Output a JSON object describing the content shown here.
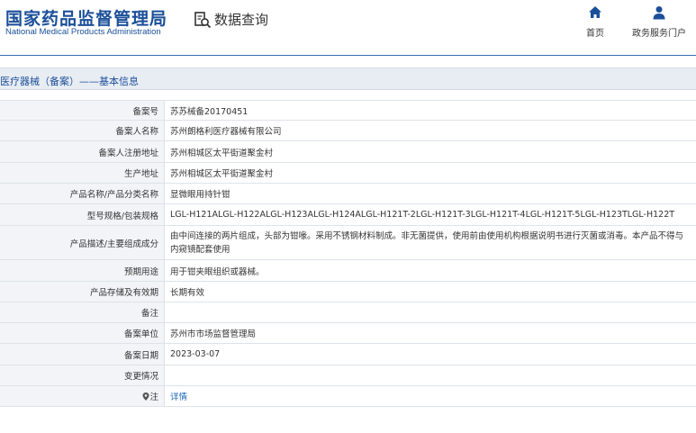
{
  "header": {
    "title": "国家药品监督管理局",
    "subtitle": "National Medical Products Administration",
    "query_label": "数据查询",
    "nav": [
      {
        "label": "首页",
        "icon": "home-icon"
      },
      {
        "label": "政务服务门户",
        "icon": "user-icon"
      }
    ]
  },
  "section": {
    "title": "医疗器械（备案）——基本信息"
  },
  "rows": [
    {
      "key": "备案号",
      "value": "苏苏械备20170451"
    },
    {
      "key": "备案人名称",
      "value": "苏州朗格利医疗器械有限公司"
    },
    {
      "key": "备案人注册地址",
      "value": "苏州相城区太平街道聚金村"
    },
    {
      "key": "生产地址",
      "value": "苏州相城区太平街道聚金村"
    },
    {
      "key": "产品名称/产品分类名称",
      "value": "显微眼用持针钳"
    },
    {
      "key": "型号规格/包装规格",
      "value": "LGL-H121ALGL-H122ALGL-H123ALGL-H124ALGL-H121T-2LGL-H121T-3LGL-H121T-4LGL-H121T-5LGL-H123TLGL-H122T"
    },
    {
      "key": "产品描述/主要组成成分",
      "value": "由中间连接的两片组成，头部为钳喙。采用不锈钢材料制成。非无菌提供，使用前由使用机构根据说明书进行灭菌或消毒。本产品不得与内窥镜配套使用"
    },
    {
      "key": "预期用途",
      "value": "用于钳夹眼组织或器械。"
    },
    {
      "key": "产品存储及有效期",
      "value": "长期有效"
    },
    {
      "key": "备注",
      "value": ""
    },
    {
      "key": "备案单位",
      "value": "苏州市市场监督管理局"
    },
    {
      "key": "备案日期",
      "value": "2023-03-07"
    },
    {
      "key": "变更情况",
      "value": ""
    },
    {
      "key": "注",
      "value": "详情"
    }
  ],
  "colors": {
    "brand_blue": "#1b4f99",
    "link_blue": "#1b66b8",
    "label_bg": "#f2f4f7",
    "section_bg": "#e8edf3"
  }
}
